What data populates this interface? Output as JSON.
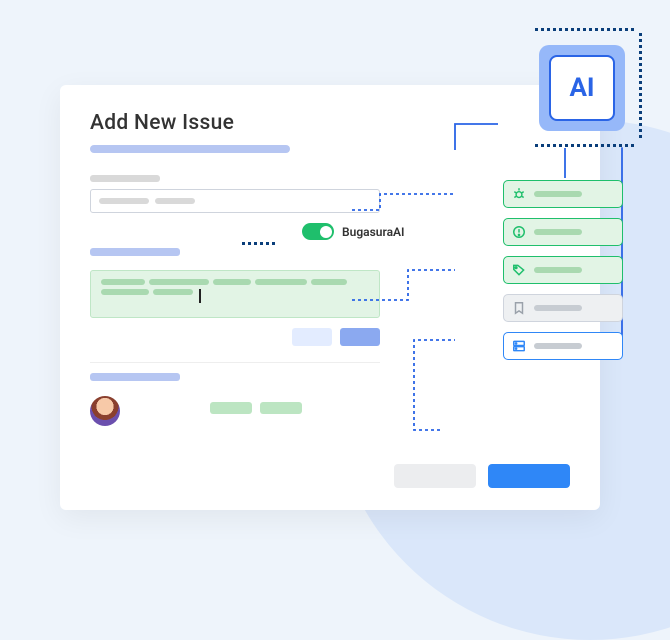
{
  "title": "Add New Issue",
  "ai_toggle": {
    "label": "BugasuraAI",
    "enabled": true
  },
  "ai_chip": {
    "label": "AI"
  },
  "pills": [
    {
      "style": "green",
      "icon": "bug-icon"
    },
    {
      "style": "green",
      "icon": "alert-circle-icon"
    },
    {
      "style": "green",
      "icon": "tag-icon"
    },
    {
      "style": "gray",
      "icon": "bookmark-icon"
    },
    {
      "style": "blue",
      "icon": "server-icon"
    }
  ],
  "colors": {
    "accent_blue": "#2f87f7",
    "accent_green": "#1fbf6c",
    "soft_blue": "#b6c6f2",
    "soft_green": "#e2f4e5"
  }
}
